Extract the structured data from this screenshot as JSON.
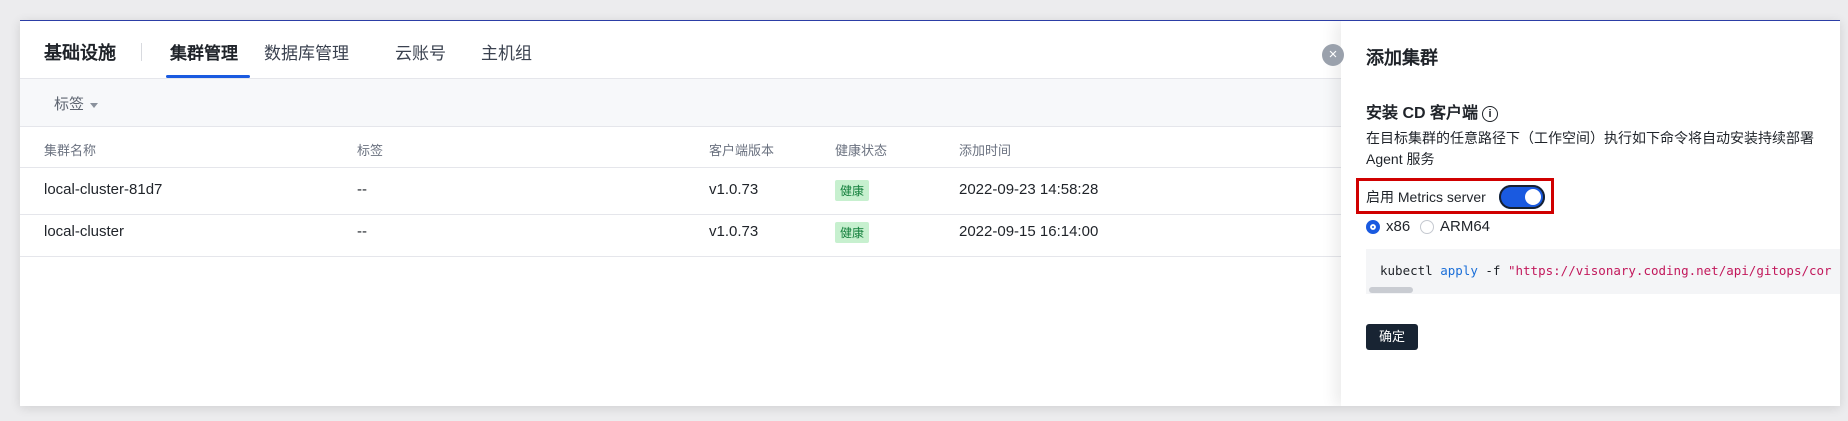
{
  "nav": {
    "title": "基础设施",
    "tabs": [
      {
        "label": "集群管理",
        "active": true
      },
      {
        "label": "数据库管理",
        "active": false
      },
      {
        "label": "云账号",
        "active": false
      },
      {
        "label": "主机组",
        "active": false
      }
    ]
  },
  "filter": {
    "tag_label": "标签"
  },
  "table": {
    "columns": [
      "集群名称",
      "标签",
      "客户端版本",
      "健康状态",
      "添加时间"
    ],
    "rows": [
      {
        "name": "local-cluster-81d7",
        "tags": "--",
        "version": "v1.0.73",
        "status": "健康",
        "added": "2022-09-23 14:58:28"
      },
      {
        "name": "local-cluster",
        "tags": "--",
        "version": "v1.0.73",
        "status": "健康",
        "added": "2022-09-15 16:14:00"
      }
    ]
  },
  "drawer": {
    "close_glyph": "×",
    "title": "添加集群",
    "section_title": "安装 CD 客户端",
    "info_glyph": "i",
    "description": "在目标集群的任意路径下（工作空间）执行如下命令将自动安装持续部署 Agent 服务",
    "metrics_label": "启用 Metrics server",
    "metrics_enabled": true,
    "arch_options": [
      {
        "label": "x86",
        "selected": true
      },
      {
        "label": "ARM64",
        "selected": false
      }
    ],
    "command": {
      "cmd": "kubectl",
      "sub": "apply",
      "flag": "-f",
      "url": "\"https://visonary.coding.net/api/gitops/cor"
    },
    "confirm_label": "确定"
  },
  "colors": {
    "accent": "#1a5ae0",
    "highlight": "#d00000",
    "healthy_bg": "#c7f0cf",
    "healthy_text": "#15803d",
    "primary_button": "#182433"
  }
}
